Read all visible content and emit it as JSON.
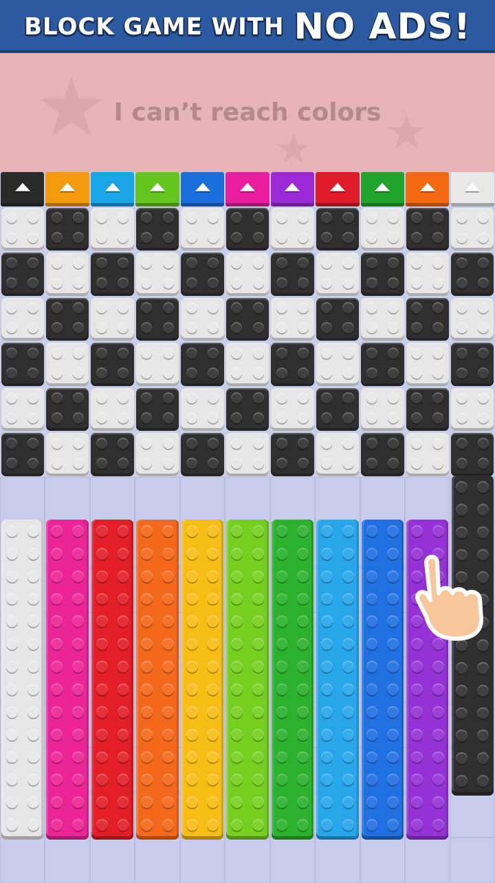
{
  "banner": {
    "text_a": "BLOCK GAME WITH",
    "text_b": "NO ADS!"
  },
  "caption": {
    "text": "I can’t reach colors"
  },
  "tabs": [
    {
      "color": "#2b2b2b"
    },
    {
      "color": "#f29a0c"
    },
    {
      "color": "#19a5e8"
    },
    {
      "color": "#63c51d"
    },
    {
      "color": "#1b6fdd"
    },
    {
      "color": "#e91e9e"
    },
    {
      "color": "#9b2ad6"
    },
    {
      "color": "#df1b2a"
    },
    {
      "color": "#20a52c"
    },
    {
      "color": "#f36a11"
    },
    {
      "color": "#e8e8e8"
    }
  ],
  "grid": {
    "rows": 6,
    "cols": 11,
    "light": "#e6e6e6",
    "dark": "#2f2f30"
  },
  "bars": [
    {
      "color": "#e6e6e6"
    },
    {
      "color": "#ec2597"
    },
    {
      "color": "#e21e27"
    },
    {
      "color": "#f3681a"
    },
    {
      "color": "#f5bd15"
    },
    {
      "color": "#76cf1f"
    },
    {
      "color": "#2bb12d"
    },
    {
      "color": "#28a6ea"
    },
    {
      "color": "#2070e2"
    },
    {
      "color": "#9532d6"
    }
  ],
  "side_column": {
    "color": "#2f2f30"
  },
  "hand": {
    "icon": "pointing-hand-icon",
    "skin": "#f7c79b",
    "outline": "#ffffff"
  }
}
